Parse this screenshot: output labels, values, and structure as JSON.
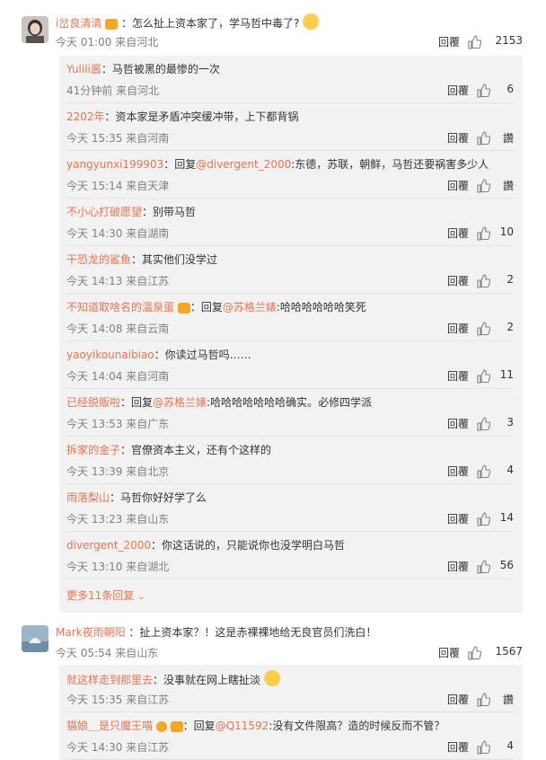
{
  "labels": {
    "reply": "回覆",
    "like": "讚"
  },
  "thread1": {
    "author": "i岔良清清",
    "text": "：怎么扯上资本家了，学马哲中毒了?",
    "time": "今天 01:00 来自河北",
    "likes": "2153",
    "replies": [
      {
        "author": "Yulili酱",
        "text": "：马哲被黑的最惨的一次",
        "time": "41分钟前 来自河北",
        "likes": "6"
      },
      {
        "author": "2202年",
        "text": "：资本家是矛盾冲突缓冲带，上下都背锅",
        "time": "今天 15:35 来自河南",
        "likes": "讚"
      },
      {
        "author": "yangyunxi199903",
        "pre": "：回复",
        "mention": "@divergent_2000",
        "text": ":东德，苏联，朝鲜，马哲还要祸害多少人",
        "time": "今天 15:14 来自天津",
        "likes": "讚"
      },
      {
        "author": "不小心打破愿望",
        "text": "：别带马哲",
        "time": "今天 14:30 来自湖南",
        "likes": "10"
      },
      {
        "author": "干恐龙的鲨鱼",
        "text": "：其实他们没学过",
        "time": "今天 14:13 来自江苏",
        "likes": "2"
      },
      {
        "author": "不知道取啥名的温泉蛋",
        "pre": "：回复",
        "mention": "@苏格兰婊",
        "text": ":哈哈哈哈哈哈笑死",
        "time": "今天 14:08 来自云南",
        "likes": "2"
      },
      {
        "author": "yaoyikounaibiao",
        "text": "：你读过马哲吗……",
        "time": "今天 14:04 来自河南",
        "likes": "11"
      },
      {
        "author": "已经脱贩啦",
        "pre": "：回复",
        "mention": "@苏格兰婊",
        "text": ":哈哈哈哈哈哈哈确实。必修四学派",
        "time": "今天 13:53 来自广东",
        "likes": "3"
      },
      {
        "author": "拆家的金子",
        "text": "：官僚资本主义，还有个这样的",
        "time": "今天 13:39 来自北京",
        "likes": "4"
      },
      {
        "author": "雨落梨山",
        "text": "：马哲你好好学了么",
        "time": "今天 13:23 来自山东",
        "likes": "14"
      },
      {
        "author": "divergent_2000",
        "text": "：你这话说的，只能说你也没学明白马哲",
        "time": "今天 13:10 来自湖北",
        "likes": "56"
      }
    ],
    "more": "更多11条回复"
  },
  "thread2": {
    "author": "Mark夜雨朝阳",
    "text": "：扯上资本家？！这是赤裸裸地给无良官员们洗白！",
    "time": "今天 05:54 来自山东",
    "likes": "1567",
    "replies": [
      {
        "author": "就这样走到那里去",
        "text": "：没事就在网上瞎扯淡",
        "time": "今天 15:35 来自江苏",
        "likes": "讚"
      },
      {
        "author": "猫娘＿是只魔王喵",
        "pre": "：回复",
        "mention": "@Q11592",
        "text": ":没有文件限高？造的时候反而不管？",
        "time": "今天 14:30 来自江苏",
        "likes": "4"
      }
    ]
  }
}
